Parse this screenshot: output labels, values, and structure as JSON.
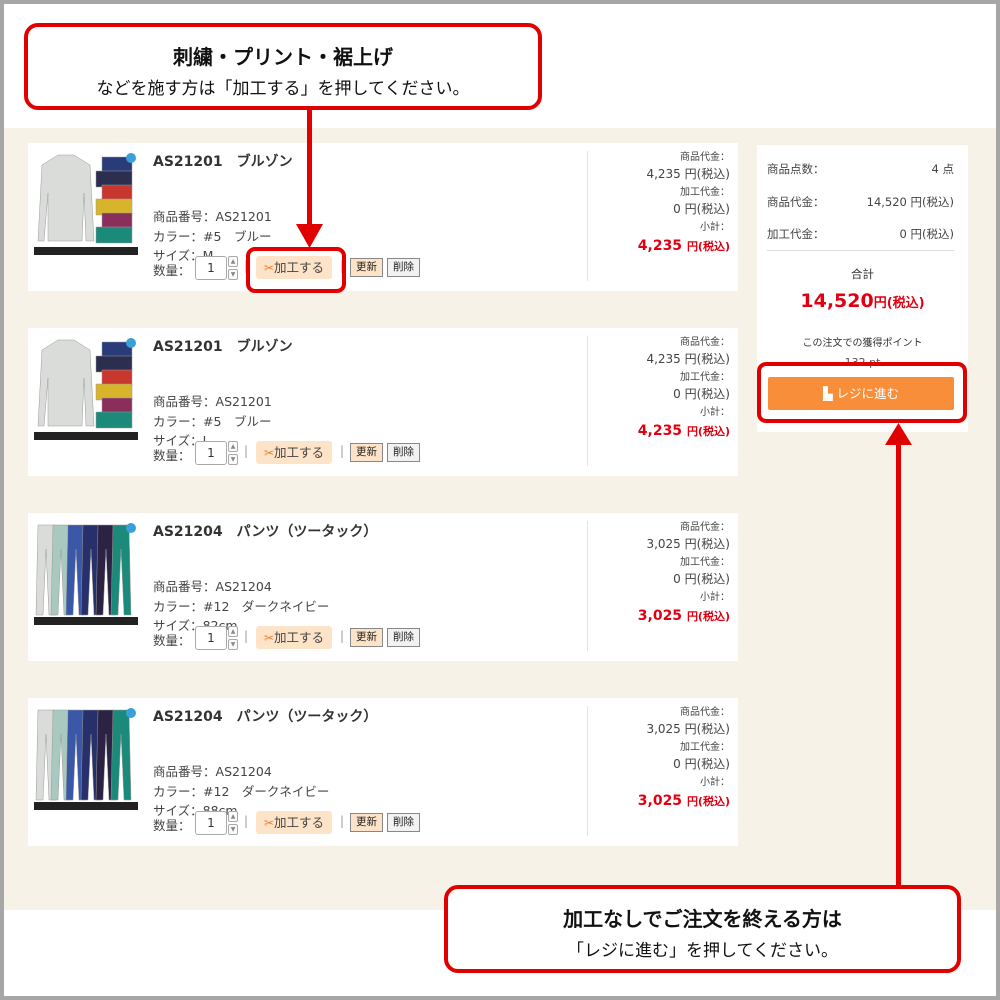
{
  "callout_top": {
    "title": "刺繍・プリント・裾上げ",
    "subtitle": "などを施す方は「加工する」を押してください。"
  },
  "callout_bottom": {
    "title": "加工なしでご注文を終える方は",
    "subtitle": "「レジに進む」を押してください。"
  },
  "labels": {
    "product_code": "商品番号：",
    "color": "カラー：",
    "size": "サイズ：",
    "quantity": "数量：",
    "process_button": "加工する",
    "update_button": "更新",
    "delete_button": "削除",
    "item_price": "商品代金：",
    "process_fee": "加工代金：",
    "subtotal": "小計："
  },
  "items": [
    {
      "name": "AS21201　ブルゾン",
      "code": "AS21201",
      "color": "#5　ブルー",
      "size": "M",
      "quantity": "1",
      "item_price": "4,235 円(税込)",
      "process_fee": "0 円(税込)",
      "subtotal": "4,235",
      "subtotal_unit": "円(税込)",
      "thumb_label": "AS21201 ブルゾン",
      "thumb_swatches": [
        "#d9dcd8",
        "#2a3b7a",
        "#2b2e4f",
        "#c8372d",
        "#d8b42b",
        "#8a2e5c",
        "#1c8a7a"
      ]
    },
    {
      "name": "AS21201　ブルゾン",
      "code": "AS21201",
      "color": "#5　ブルー",
      "size": "L",
      "quantity": "1",
      "item_price": "4,235 円(税込)",
      "process_fee": "0 円(税込)",
      "subtotal": "4,235",
      "subtotal_unit": "円(税込)",
      "thumb_label": "AS21201 ブルゾン",
      "thumb_swatches": [
        "#d9dcd8",
        "#2a3b7a",
        "#2b2e4f",
        "#c8372d",
        "#d8b42b",
        "#8a2e5c",
        "#1c8a7a"
      ]
    },
    {
      "name": "AS21204　パンツ（ツータック）",
      "code": "AS21204",
      "color": "#12　ダークネイビー",
      "size": "82cm",
      "quantity": "1",
      "item_price": "3,025 円(税込)",
      "process_fee": "0 円(税込)",
      "subtotal": "3,025",
      "subtotal_unit": "円(税込)",
      "thumb_label": "AS21204 パンツ(ツータック)",
      "thumb_swatches": [
        "#d9dcd8",
        "#a8c8c0",
        "#3a57a8",
        "#27306a",
        "#2b2244",
        "#1c8a7a"
      ]
    },
    {
      "name": "AS21204　パンツ（ツータック）",
      "code": "AS21204",
      "color": "#12　ダークネイビー",
      "size": "88cm",
      "quantity": "1",
      "item_price": "3,025 円(税込)",
      "process_fee": "0 円(税込)",
      "subtotal": "3,025",
      "subtotal_unit": "円(税込)",
      "thumb_label": "AS21204 パンツ(ツータック)",
      "thumb_swatches": [
        "#d9dcd8",
        "#a8c8c0",
        "#3a57a8",
        "#27306a",
        "#2b2244",
        "#1c8a7a"
      ]
    }
  ],
  "summary": {
    "item_count_label": "商品点数：",
    "item_count": "4 点",
    "item_total_label": "商品代金：",
    "item_total": "14,520 円(税込)",
    "process_total_label": "加工代金：",
    "process_total": "0 円(税込)",
    "grand_total_label": "合計",
    "grand_total": "14,520",
    "grand_total_unit": "円(税込)",
    "points_label": "この注文での獲得ポイント",
    "points_value": "132 pt",
    "checkout_label": "レジに進む"
  },
  "colors": {
    "accent_red": "#e10000",
    "price_red": "#e10012",
    "checkout_orange": "#f98e3a",
    "process_button_bg": "#fde3c8",
    "page_bg": "#f6f2e8"
  },
  "icons": {
    "process_button": "scissors-icon",
    "checkout_button": "register-icon"
  }
}
